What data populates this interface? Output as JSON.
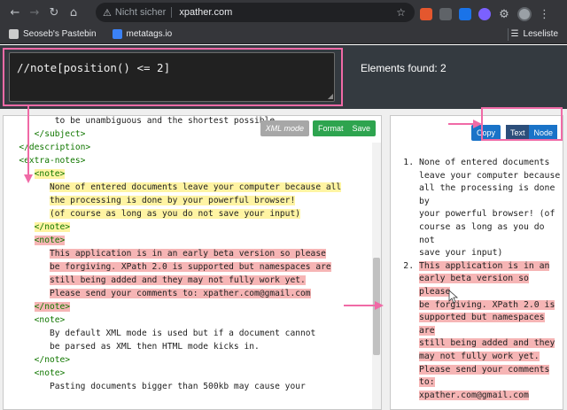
{
  "browser": {
    "omnibox": {
      "security": "Nicht sicher",
      "url": "xpather.com"
    },
    "bookmarks": [
      {
        "label": "Seoseb's Pastebin",
        "color": "#cccccc"
      },
      {
        "label": "metatags.io",
        "color": "#3b82f6"
      }
    ],
    "reading_list": "Leseliste"
  },
  "app": {
    "xpath_query": "//note[position() <= 2]",
    "elements_found": "Elements found: 2",
    "editor_toolbar": {
      "xml_mode": "XML mode",
      "format": "Format",
      "save": "Save"
    },
    "result_toolbar": {
      "copy": "Copy",
      "text": "Text",
      "node": "Node"
    }
  },
  "editor_lines": [
    {
      "indent": 10,
      "segments": [
        {
          "t": "to be unambiguous and the shortest possible.",
          "c": "text"
        }
      ],
      "hl": ""
    },
    {
      "indent": 6,
      "segments": [
        {
          "t": "</subject>",
          "c": "tag"
        }
      ],
      "hl": ""
    },
    {
      "indent": 3,
      "segments": [
        {
          "t": "</description>",
          "c": "tag"
        }
      ],
      "hl": ""
    },
    {
      "indent": 3,
      "segments": [
        {
          "t": "<extra-notes>",
          "c": "tag"
        }
      ],
      "hl": ""
    },
    {
      "indent": 6,
      "segments": [
        {
          "t": "<note>",
          "c": "tag"
        }
      ],
      "hl": "y"
    },
    {
      "indent": 9,
      "segments": [
        {
          "t": "None of entered documents leave your computer because all",
          "c": "text"
        }
      ],
      "hl": "y"
    },
    {
      "indent": 9,
      "segments": [
        {
          "t": "the processing is done by your powerful browser!",
          "c": "text"
        }
      ],
      "hl": "y"
    },
    {
      "indent": 9,
      "segments": [
        {
          "t": "(of course as long as you do not save your input)",
          "c": "text"
        }
      ],
      "hl": "y"
    },
    {
      "indent": 6,
      "segments": [
        {
          "t": "</note>",
          "c": "tag"
        }
      ],
      "hl": "y"
    },
    {
      "indent": 6,
      "segments": [
        {
          "t": "<note>",
          "c": "tag"
        }
      ],
      "hl": "r"
    },
    {
      "indent": 9,
      "segments": [
        {
          "t": "This application is in an early beta version so please",
          "c": "text"
        }
      ],
      "hl": "r"
    },
    {
      "indent": 9,
      "segments": [
        {
          "t": "be forgiving. XPath 2.0 is supported but namespaces are",
          "c": "text"
        }
      ],
      "hl": "r"
    },
    {
      "indent": 9,
      "segments": [
        {
          "t": "still being added and they may not fully work yet.",
          "c": "text"
        }
      ],
      "hl": "r"
    },
    {
      "indent": 9,
      "segments": [
        {
          "t": "Please send your comments to: xpather.com@gmail.com",
          "c": "text"
        }
      ],
      "hl": "r"
    },
    {
      "indent": 6,
      "segments": [
        {
          "t": "</note>",
          "c": "tag"
        }
      ],
      "hl": "r"
    },
    {
      "indent": 6,
      "segments": [
        {
          "t": "<note>",
          "c": "tag"
        }
      ],
      "hl": ""
    },
    {
      "indent": 9,
      "segments": [
        {
          "t": "By default XML mode is used but if a document cannot",
          "c": "text"
        }
      ],
      "hl": ""
    },
    {
      "indent": 9,
      "segments": [
        {
          "t": "be parsed as XML then HTML mode kicks in.",
          "c": "text"
        }
      ],
      "hl": ""
    },
    {
      "indent": 6,
      "segments": [
        {
          "t": "</note>",
          "c": "tag"
        }
      ],
      "hl": ""
    },
    {
      "indent": 6,
      "segments": [
        {
          "t": "<note>",
          "c": "tag"
        }
      ],
      "hl": ""
    },
    {
      "indent": 9,
      "segments": [
        {
          "t": "Pasting documents bigger than 500kb may cause your",
          "c": "text"
        }
      ],
      "hl": ""
    }
  ],
  "results": [
    {
      "lines": [
        "None of entered documents",
        "leave your computer because",
        "all the processing is done by",
        "your powerful browser! (of",
        "course as long as you do not",
        "save your input)"
      ],
      "highlight": false
    },
    {
      "lines": [
        "This application is in an",
        "early beta version so please",
        "be forgiving. XPath 2.0 is",
        "supported but namespaces are",
        "still being added and they",
        "may not fully work yet.",
        "Please send your comments to:",
        "xpather.com@gmail.com"
      ],
      "highlight": true
    }
  ],
  "colors": {
    "annotation": "#f06aa6",
    "highlight_yellow": "#fff4a3",
    "highlight_red": "#f6b5b5",
    "tag_green": "#117700"
  }
}
